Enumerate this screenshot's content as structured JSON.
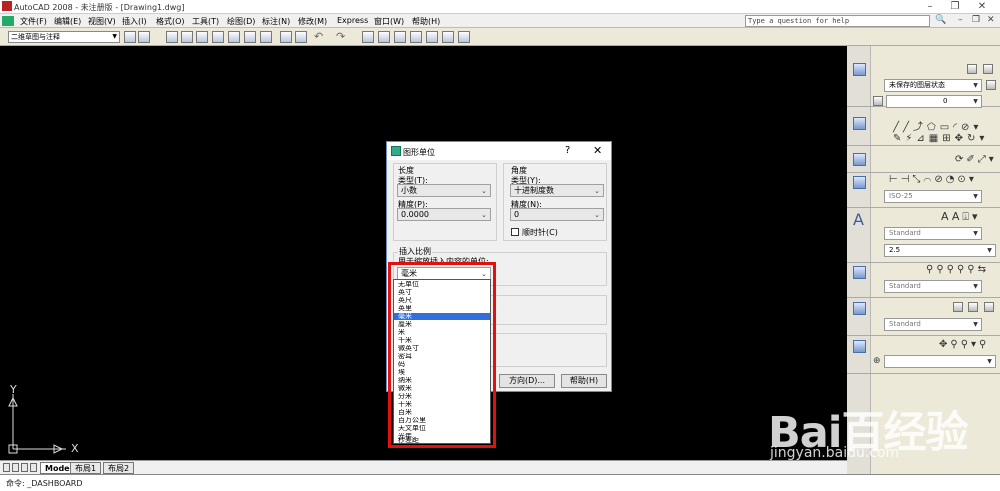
{
  "window": {
    "title": "AutoCAD 2008 - 未注册版 - [Drawing1.dwg]",
    "buttons": [
      "–",
      "❐",
      "✕"
    ]
  },
  "menubar": {
    "items": [
      "文件(F)",
      "编辑(E)",
      "视图(V)",
      "插入(I)",
      "格式(O)",
      "工具(T)",
      "绘图(D)",
      "标注(N)",
      "修改(M)",
      "Express",
      "窗口(W)",
      "帮助(H)"
    ],
    "help_search_placeholder": "Type a question for help"
  },
  "toolbar": {
    "workspace": "二维草图与注释",
    "icons": [
      "workspace-settings",
      "new",
      "open",
      "save",
      "plot",
      "plot-preview",
      "publish",
      "cut",
      "match-properties",
      "undo",
      "redo",
      "pan",
      "zoom",
      "properties",
      "design-center",
      "tool-palettes",
      "sheet-set",
      "markup",
      "calculator",
      "help"
    ]
  },
  "palette": {
    "layer_state": "未保存的图层状态",
    "layer_current": "0",
    "dim_style": "ISO-25",
    "text_style": "Standard",
    "text_height": "2.5",
    "mleader_style": "Standard",
    "table_style": "Standard"
  },
  "drawing": {
    "ucs_y": "Y",
    "ucs_x": "X"
  },
  "tabs": [
    "Model",
    "布局1",
    "布局2"
  ],
  "command_line": "命令: _DASHBOARD",
  "dialog": {
    "title": "图形单位",
    "help_glyph": "?",
    "close_glyph": "✕",
    "length": {
      "heading": "长度",
      "type_label": "类型(T):",
      "type_value": "小数",
      "precision_label": "精度(P):",
      "precision_value": "0.0000"
    },
    "angle": {
      "heading": "角度",
      "type_label": "类型(Y):",
      "type_value": "十进制度数",
      "precision_label": "精度(N):",
      "precision_value": "0",
      "clockwise_label": "顺时针(C)"
    },
    "insert_scale": {
      "heading": "插入比例",
      "desc": "用于缩放插入内容的单位:",
      "value": "毫米"
    },
    "buttons": {
      "direction": "方向(D)...",
      "help": "帮助(H)"
    },
    "unit_options": [
      "无单位",
      "英寸",
      "英尺",
      "英里",
      "毫米",
      "厘米",
      "米",
      "千米",
      "微英寸",
      "密耳",
      "码",
      "埃",
      "纳米",
      "微米",
      "分米",
      "十米",
      "百米",
      "百万公里",
      "天文单位",
      "光年",
      "秒差距"
    ],
    "selected_unit": "毫米"
  },
  "watermark": {
    "logo": "Bai百经验",
    "url": "jingyan.baidu.com"
  }
}
